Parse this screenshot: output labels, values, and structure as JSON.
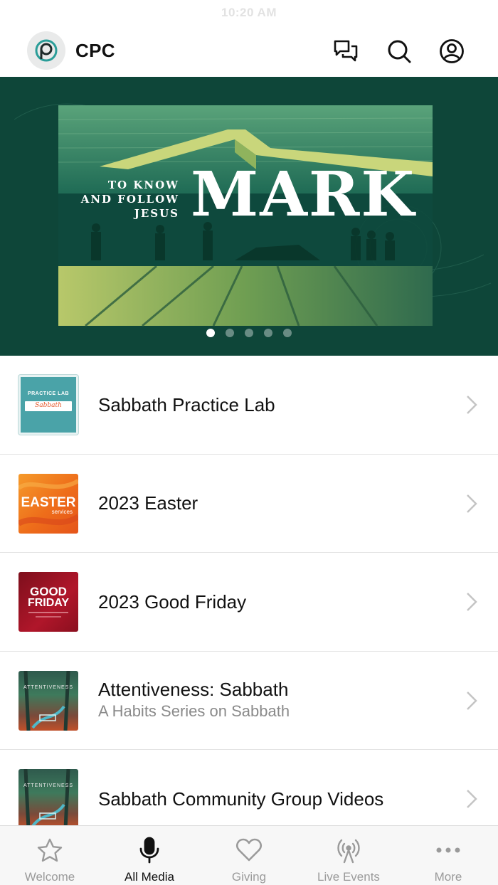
{
  "status_bar": {
    "time": "10:20 AM"
  },
  "header": {
    "title": "CPC",
    "logo_icon": "cpc-logo-icon",
    "icons": [
      "chat-bubbles-icon",
      "search-icon",
      "account-icon"
    ]
  },
  "hero": {
    "banner": {
      "kicker_lines": [
        "TO KNOW",
        "AND FOLLOW",
        "JESUS"
      ],
      "title": "MARK"
    },
    "slide_count": 5,
    "active_slide": 1
  },
  "media_list": [
    {
      "title": "Sabbath Practice Lab",
      "subtitle": "",
      "thumb": {
        "line1": "PRACTICE LAB",
        "line2": "Sabbath"
      }
    },
    {
      "title": "2023 Easter",
      "subtitle": "",
      "thumb": {
        "line1": "EASTER",
        "line2": "services"
      }
    },
    {
      "title": "2023 Good Friday",
      "subtitle": "",
      "thumb": {
        "line1": "GOOD",
        "line2": "FRIDAY"
      }
    },
    {
      "title": "Attentiveness: Sabbath",
      "subtitle": "A Habits Series on Sabbath",
      "thumb": {
        "line1": "ATTENTIVENESS",
        "line2": ""
      }
    },
    {
      "title": "Sabbath Community Group Videos",
      "subtitle": "",
      "thumb": {
        "line1": "ATTENTIVENESS",
        "line2": ""
      }
    }
  ],
  "tabs": [
    {
      "label": "Welcome",
      "icon": "star-icon",
      "active": false
    },
    {
      "label": "All Media",
      "icon": "microphone-icon",
      "active": true
    },
    {
      "label": "Giving",
      "icon": "heart-icon",
      "active": false
    },
    {
      "label": "Live Events",
      "icon": "broadcast-tower-icon",
      "active": false
    },
    {
      "label": "More",
      "icon": "more-dots-icon",
      "active": false
    }
  ],
  "colors": {
    "hero_green": "#0f4a3d",
    "sea_green": "#3a8c66",
    "teal_accent": "#4aa3a8",
    "easter_orange": "#f07a1c",
    "good_friday_red": "#b0162a",
    "tab_active": "#111111",
    "tab_inactive": "#9a9a9a"
  }
}
